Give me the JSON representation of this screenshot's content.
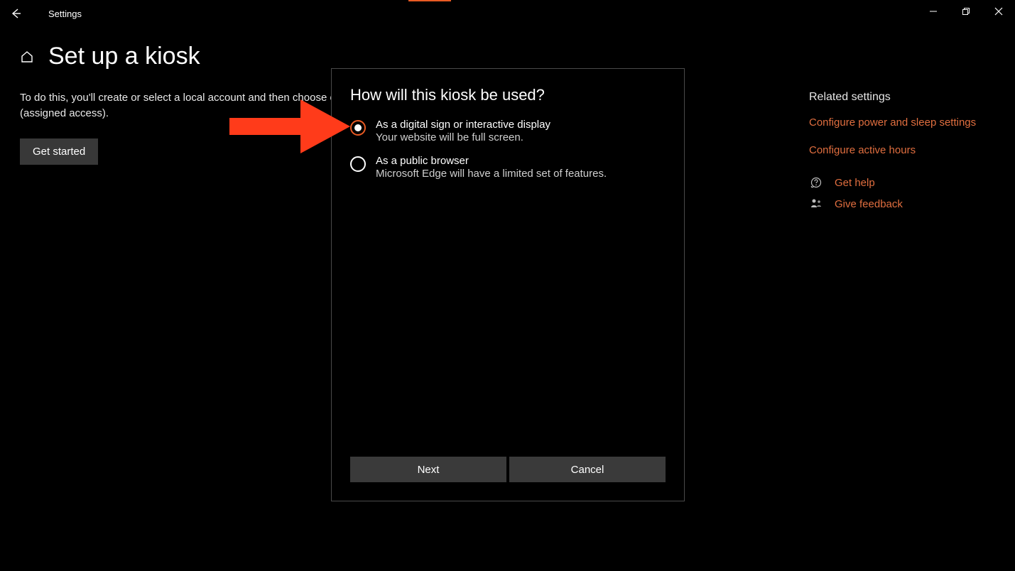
{
  "window": {
    "app_title": "Settings"
  },
  "page": {
    "title": "Set up a kiosk",
    "description": "To do this, you'll create or select a local account and then choose only app that it can use (assigned access).",
    "get_started": "Get started"
  },
  "sidebar": {
    "heading": "Related settings",
    "links": [
      "Configure power and sleep settings",
      "Configure active hours"
    ],
    "help_link": "Get help",
    "feedback_link": "Give feedback"
  },
  "dialog": {
    "title": "How will this kiosk be used?",
    "options": [
      {
        "label": "As a digital sign or interactive display",
        "desc": "Your website will be full screen.",
        "selected": true
      },
      {
        "label": "As a public browser",
        "desc": "Microsoft Edge will have a limited set of features.",
        "selected": false
      }
    ],
    "next": "Next",
    "cancel": "Cancel"
  }
}
